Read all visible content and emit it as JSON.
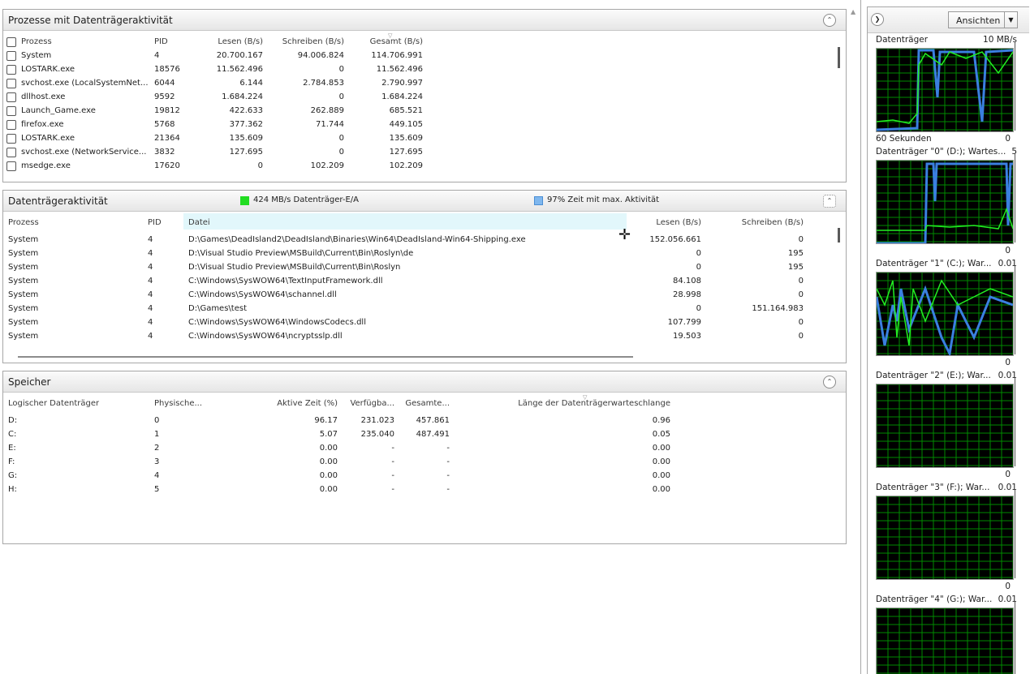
{
  "processes_panel": {
    "title": "Prozesse mit Datenträgeraktivität",
    "columns": [
      "Prozess",
      "PID",
      "Lesen (B/s)",
      "Schreiben (B/s)",
      "Gesamt (B/s)"
    ],
    "rows": [
      {
        "name": "System",
        "pid": "4",
        "read": "20.700.167",
        "write": "94.006.824",
        "total": "114.706.991"
      },
      {
        "name": "LOSTARK.exe",
        "pid": "18576",
        "read": "11.562.496",
        "write": "0",
        "total": "11.562.496"
      },
      {
        "name": "svchost.exe (LocalSystemNet...",
        "pid": "6044",
        "read": "6.144",
        "write": "2.784.853",
        "total": "2.790.997"
      },
      {
        "name": "dllhost.exe",
        "pid": "9592",
        "read": "1.684.224",
        "write": "0",
        "total": "1.684.224"
      },
      {
        "name": "Launch_Game.exe",
        "pid": "19812",
        "read": "422.633",
        "write": "262.889",
        "total": "685.521"
      },
      {
        "name": "firefox.exe",
        "pid": "5768",
        "read": "377.362",
        "write": "71.744",
        "total": "449.105"
      },
      {
        "name": "LOSTARK.exe",
        "pid": "21364",
        "read": "135.609",
        "write": "0",
        "total": "135.609"
      },
      {
        "name": "svchost.exe (NetworkService...",
        "pid": "3832",
        "read": "127.695",
        "write": "0",
        "total": "127.695"
      },
      {
        "name": "msedge.exe",
        "pid": "17620",
        "read": "0",
        "write": "102.209",
        "total": "102.209"
      }
    ]
  },
  "disk_activity_panel": {
    "title": "Datenträgeraktivität",
    "legend_io": "424 MB/s Datenträger-E/A",
    "legend_io_color": "#22dd22",
    "legend_time": "97% Zeit mit max. Aktivität",
    "legend_time_color": "#7fb7ee",
    "columns": [
      "Prozess",
      "PID",
      "Datei",
      "Lesen (B/s)",
      "Schreiben (B/s)"
    ],
    "rows": [
      {
        "name": "System",
        "pid": "4",
        "file": "D:\\Games\\DeadIsland2\\DeadIsland\\Binaries\\Win64\\DeadIsland-Win64-Shipping.exe",
        "read": "152.056.661",
        "write": "0"
      },
      {
        "name": "System",
        "pid": "4",
        "file": "D:\\Visual Studio Preview\\MSBuild\\Current\\Bin\\Roslyn\\de",
        "read": "0",
        "write": "195"
      },
      {
        "name": "System",
        "pid": "4",
        "file": "D:\\Visual Studio Preview\\MSBuild\\Current\\Bin\\Roslyn",
        "read": "0",
        "write": "195"
      },
      {
        "name": "System",
        "pid": "4",
        "file": "C:\\Windows\\SysWOW64\\TextInputFramework.dll",
        "read": "84.108",
        "write": "0"
      },
      {
        "name": "System",
        "pid": "4",
        "file": "C:\\Windows\\SysWOW64\\schannel.dll",
        "read": "28.998",
        "write": "0"
      },
      {
        "name": "System",
        "pid": "4",
        "file": "D:\\Games\\test",
        "read": "0",
        "write": "151.164.983"
      },
      {
        "name": "System",
        "pid": "4",
        "file": "C:\\Windows\\SysWOW64\\WindowsCodecs.dll",
        "read": "107.799",
        "write": "0"
      },
      {
        "name": "System",
        "pid": "4",
        "file": "C:\\Windows\\SysWOW64\\ncryptsslp.dll",
        "read": "19.503",
        "write": "0"
      }
    ]
  },
  "storage_panel": {
    "title": "Speicher",
    "columns": [
      "Logischer Datenträger",
      "Physische...",
      "Aktive Zeit (%)",
      "Verfügba...",
      "Gesamte...",
      "Länge der Datenträgerwarteschlange"
    ],
    "rows": [
      {
        "drive": "D:",
        "phys": "0",
        "active": "96.17",
        "avail": "231.023",
        "total": "457.861",
        "queue": "0.96"
      },
      {
        "drive": "C:",
        "phys": "1",
        "active": "5.07",
        "avail": "235.040",
        "total": "487.491",
        "queue": "0.05"
      },
      {
        "drive": "E:",
        "phys": "2",
        "active": "0.00",
        "avail": "-",
        "total": "-",
        "queue": "0.00"
      },
      {
        "drive": "F:",
        "phys": "3",
        "active": "0.00",
        "avail": "-",
        "total": "-",
        "queue": "0.00"
      },
      {
        "drive": "G:",
        "phys": "4",
        "active": "0.00",
        "avail": "-",
        "total": "-",
        "queue": "0.00"
      },
      {
        "drive": "H:",
        "phys": "5",
        "active": "0.00",
        "avail": "-",
        "total": "-",
        "queue": "0.00"
      }
    ]
  },
  "sidebar": {
    "views_button": "Ansichten",
    "graphs": [
      {
        "title": "Datenträger",
        "max": "10 MB/s",
        "foot_left": "60 Sekunden",
        "foot_zero": "0"
      },
      {
        "title": "Datenträger \"0\" (D:); Wartes...",
        "max": "5",
        "foot_left": "",
        "foot_zero": "0"
      },
      {
        "title": "Datenträger \"1\" (C:); War...",
        "max": "0.01",
        "foot_left": "",
        "foot_zero": "0"
      },
      {
        "title": "Datenträger \"2\" (E:); War...",
        "max": "0.01",
        "foot_left": "",
        "foot_zero": "0"
      },
      {
        "title": "Datenträger \"3\" (F:); War...",
        "max": "0.01",
        "foot_left": "",
        "foot_zero": "0"
      },
      {
        "title": "Datenträger \"4\" (G:); War...",
        "max": "0.01",
        "foot_left": "",
        "foot_zero": ""
      }
    ]
  },
  "icons": {
    "collapse": "chevron-up-icon",
    "expand_sidebar": "chevron-right-icon",
    "dropdown": "caret-down-icon",
    "cursor": "move-cursor-icon"
  },
  "colors": {
    "graph_bg": "#000000",
    "graph_grid": "#008a00",
    "graph_line_green": "#22ee22",
    "graph_line_blue": "#3a7fe0"
  }
}
